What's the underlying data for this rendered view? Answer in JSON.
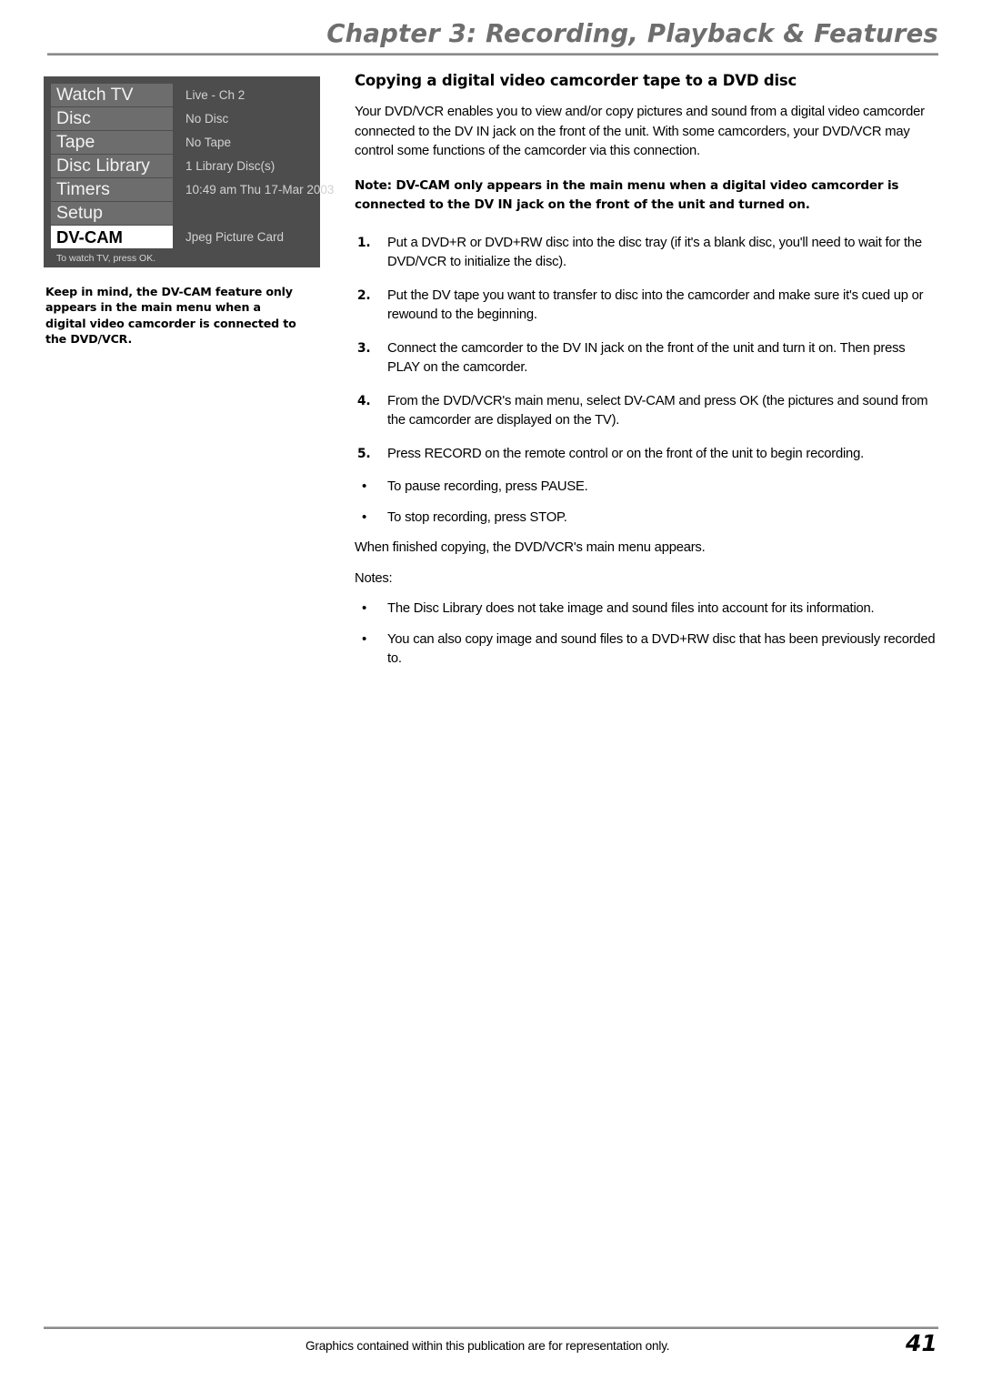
{
  "header": {
    "chapter_title": "Chapter 3: Recording, Playback & Features"
  },
  "osd_menu": {
    "items": [
      {
        "label": "Watch TV",
        "status": "Live - Ch 2",
        "selected": false
      },
      {
        "label": "Disc",
        "status": "No Disc",
        "selected": false
      },
      {
        "label": "Tape",
        "status": "No Tape",
        "selected": false
      },
      {
        "label": "Disc Library",
        "status": "1 Library Disc(s)",
        "selected": false
      },
      {
        "label": "Timers",
        "status": "10:49 am Thu 17-Mar 2003",
        "selected": false
      },
      {
        "label": "Setup",
        "status": "",
        "selected": false
      },
      {
        "label": "DV-CAM",
        "status": "Jpeg Picture Card",
        "selected": true
      }
    ],
    "hint": "To watch TV, press OK."
  },
  "osd_caption": {
    "text_prefix": "Keep in mind, the ",
    "bold_1": "DV-CAM",
    "text_middle": " feature only appears in the main menu when a digital video camcorder is connected to the ",
    "bold_2": "DVD/VCR",
    "text_suffix": "."
  },
  "main": {
    "section_title": "Copying a digital video camcorder tape to a DVD disc",
    "intro": "Your DVD/VCR enables you to view and/or copy pictures and sound from a digital video camcorder connected to the DV IN jack on the front of the unit. With some camcorders, your DVD/VCR may control some functions of the camcorder via this connection.",
    "note": "Note: DV-CAM only appears in the main menu when a digital video camcorder is connected to the DV IN jack on the front of the unit and turned on.",
    "steps": [
      {
        "num": "1.",
        "text": "Put a DVD+R or DVD+RW disc into the disc tray (if it's a blank disc, you'll need to wait for the DVD/VCR to initialize the disc)."
      },
      {
        "num": "2.",
        "text": "Put the DV tape you want to transfer to disc into the camcorder and make sure it's cued up or rewound to the beginning."
      },
      {
        "num": "3.",
        "text": "Connect the camcorder to the DV IN jack on the front of the unit and turn it on. Then press PLAY on the camcorder."
      },
      {
        "num": "4.",
        "text": "From the DVD/VCR's main menu, select DV-CAM and press OK (the pictures and sound from the camcorder are displayed on the TV)."
      },
      {
        "num": "5.",
        "text": "Press RECORD on the remote control or on the front of the unit to begin recording."
      }
    ],
    "sub_bullets": [
      {
        "dot": "•",
        "text": "To pause recording, press PAUSE."
      },
      {
        "dot": "•",
        "text": "To stop recording, press STOP."
      }
    ],
    "finish_line": "When finished copying, the DVD/VCR's main menu appears.",
    "notes_label": "Notes:",
    "notes": [
      {
        "dot": "•",
        "text": "The Disc Library does not take image and sound files into account for its information."
      },
      {
        "dot": "•",
        "text": "You can also copy image and sound files to a DVD+RW disc that has been previously recorded to."
      }
    ]
  },
  "footer": {
    "note": "Graphics contained within this publication are for representation only.",
    "page_number": "41"
  },
  "colors": {
    "header_gray": "#6e6e6e",
    "osd_panel_bg": "#4d4d4d",
    "osd_button_bg": "#6d6d6d",
    "osd_selected_bg": "#ffffff",
    "osd_text": "#f2f2f2",
    "osd_status_text": "#d2d2d2",
    "rule_gray": "#8a8a8a"
  }
}
